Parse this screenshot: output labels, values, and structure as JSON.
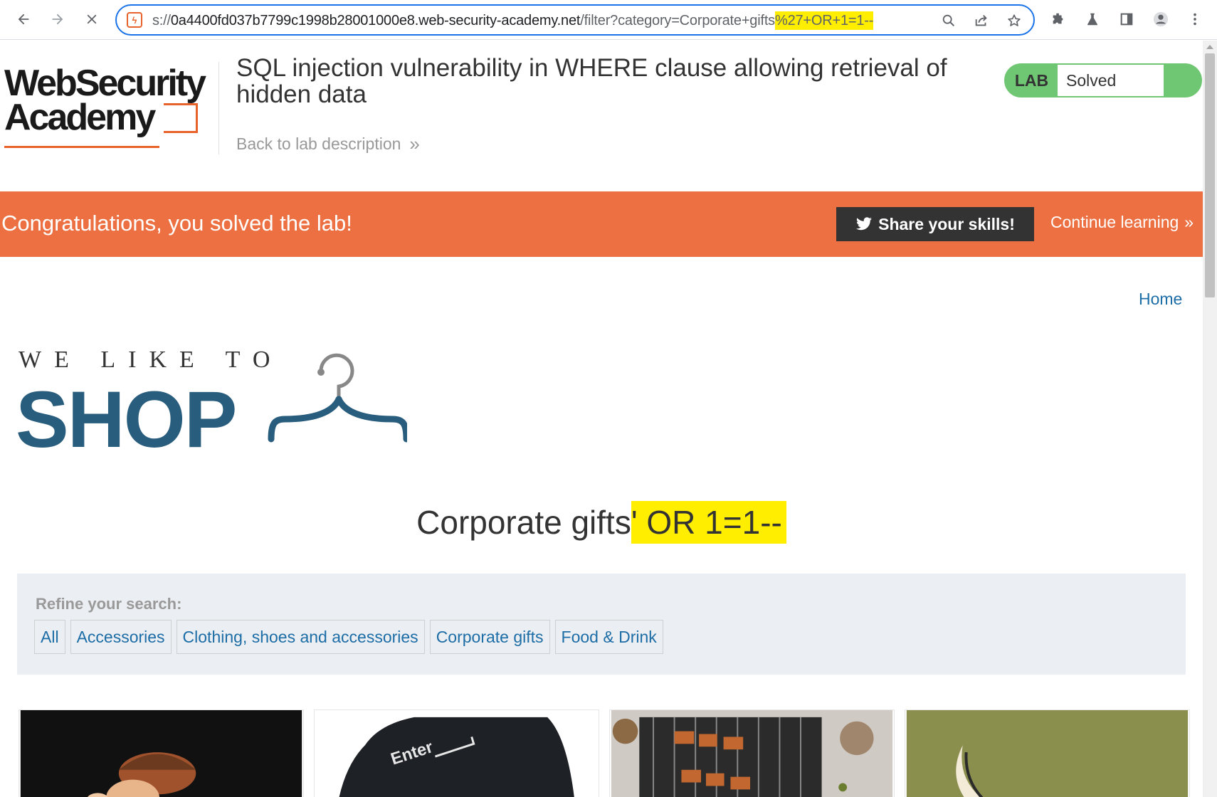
{
  "browser": {
    "url": {
      "scheme": "s://",
      "host": "0a4400fd037b7799c1998b28001000e8.web-security-academy.net",
      "path": "/filter?category=Corporate+gifts",
      "injected": "%27+OR+1=1--"
    },
    "nav": {
      "back_icon": "arrow-left-icon",
      "forward_icon": "arrow-right-icon",
      "stop_icon": "close-icon"
    },
    "highlight_color": "#ffee00",
    "focus_color": "#1a73e8"
  },
  "lab_header": {
    "logo": {
      "line1": "WebSecurity",
      "line2": "Academy"
    },
    "title": "SQL injection vulnerability in WHERE clause allowing retrieval of hidden data",
    "back_link": "Back to lab description",
    "status": {
      "badge": "LAB",
      "state": "Solved",
      "color": "#70c773"
    }
  },
  "banner": {
    "message": "Congratulations, you solved the lab!",
    "share_label": "Share your skills!",
    "continue_label": "Continue learning",
    "color": "#ec7042"
  },
  "shop": {
    "home_link": "Home",
    "logo": {
      "tagline": "WE LIKE TO",
      "word": "SHOP",
      "color": "#295d7d"
    },
    "category": {
      "base": "Corporate gifts",
      "injected": "' OR 1=1--"
    },
    "refine_label": "Refine your search:",
    "filters": [
      "All",
      "Accessories",
      "Clothing, shoes and accessories",
      "Corporate gifts",
      "Food & Drink"
    ],
    "products": [
      {
        "image": "cartoon-figure-image"
      },
      {
        "image": "enter-key-image",
        "text": "Enter"
      },
      {
        "image": "bbq-skewers-image"
      },
      {
        "image": "pet-toy-image"
      }
    ]
  }
}
